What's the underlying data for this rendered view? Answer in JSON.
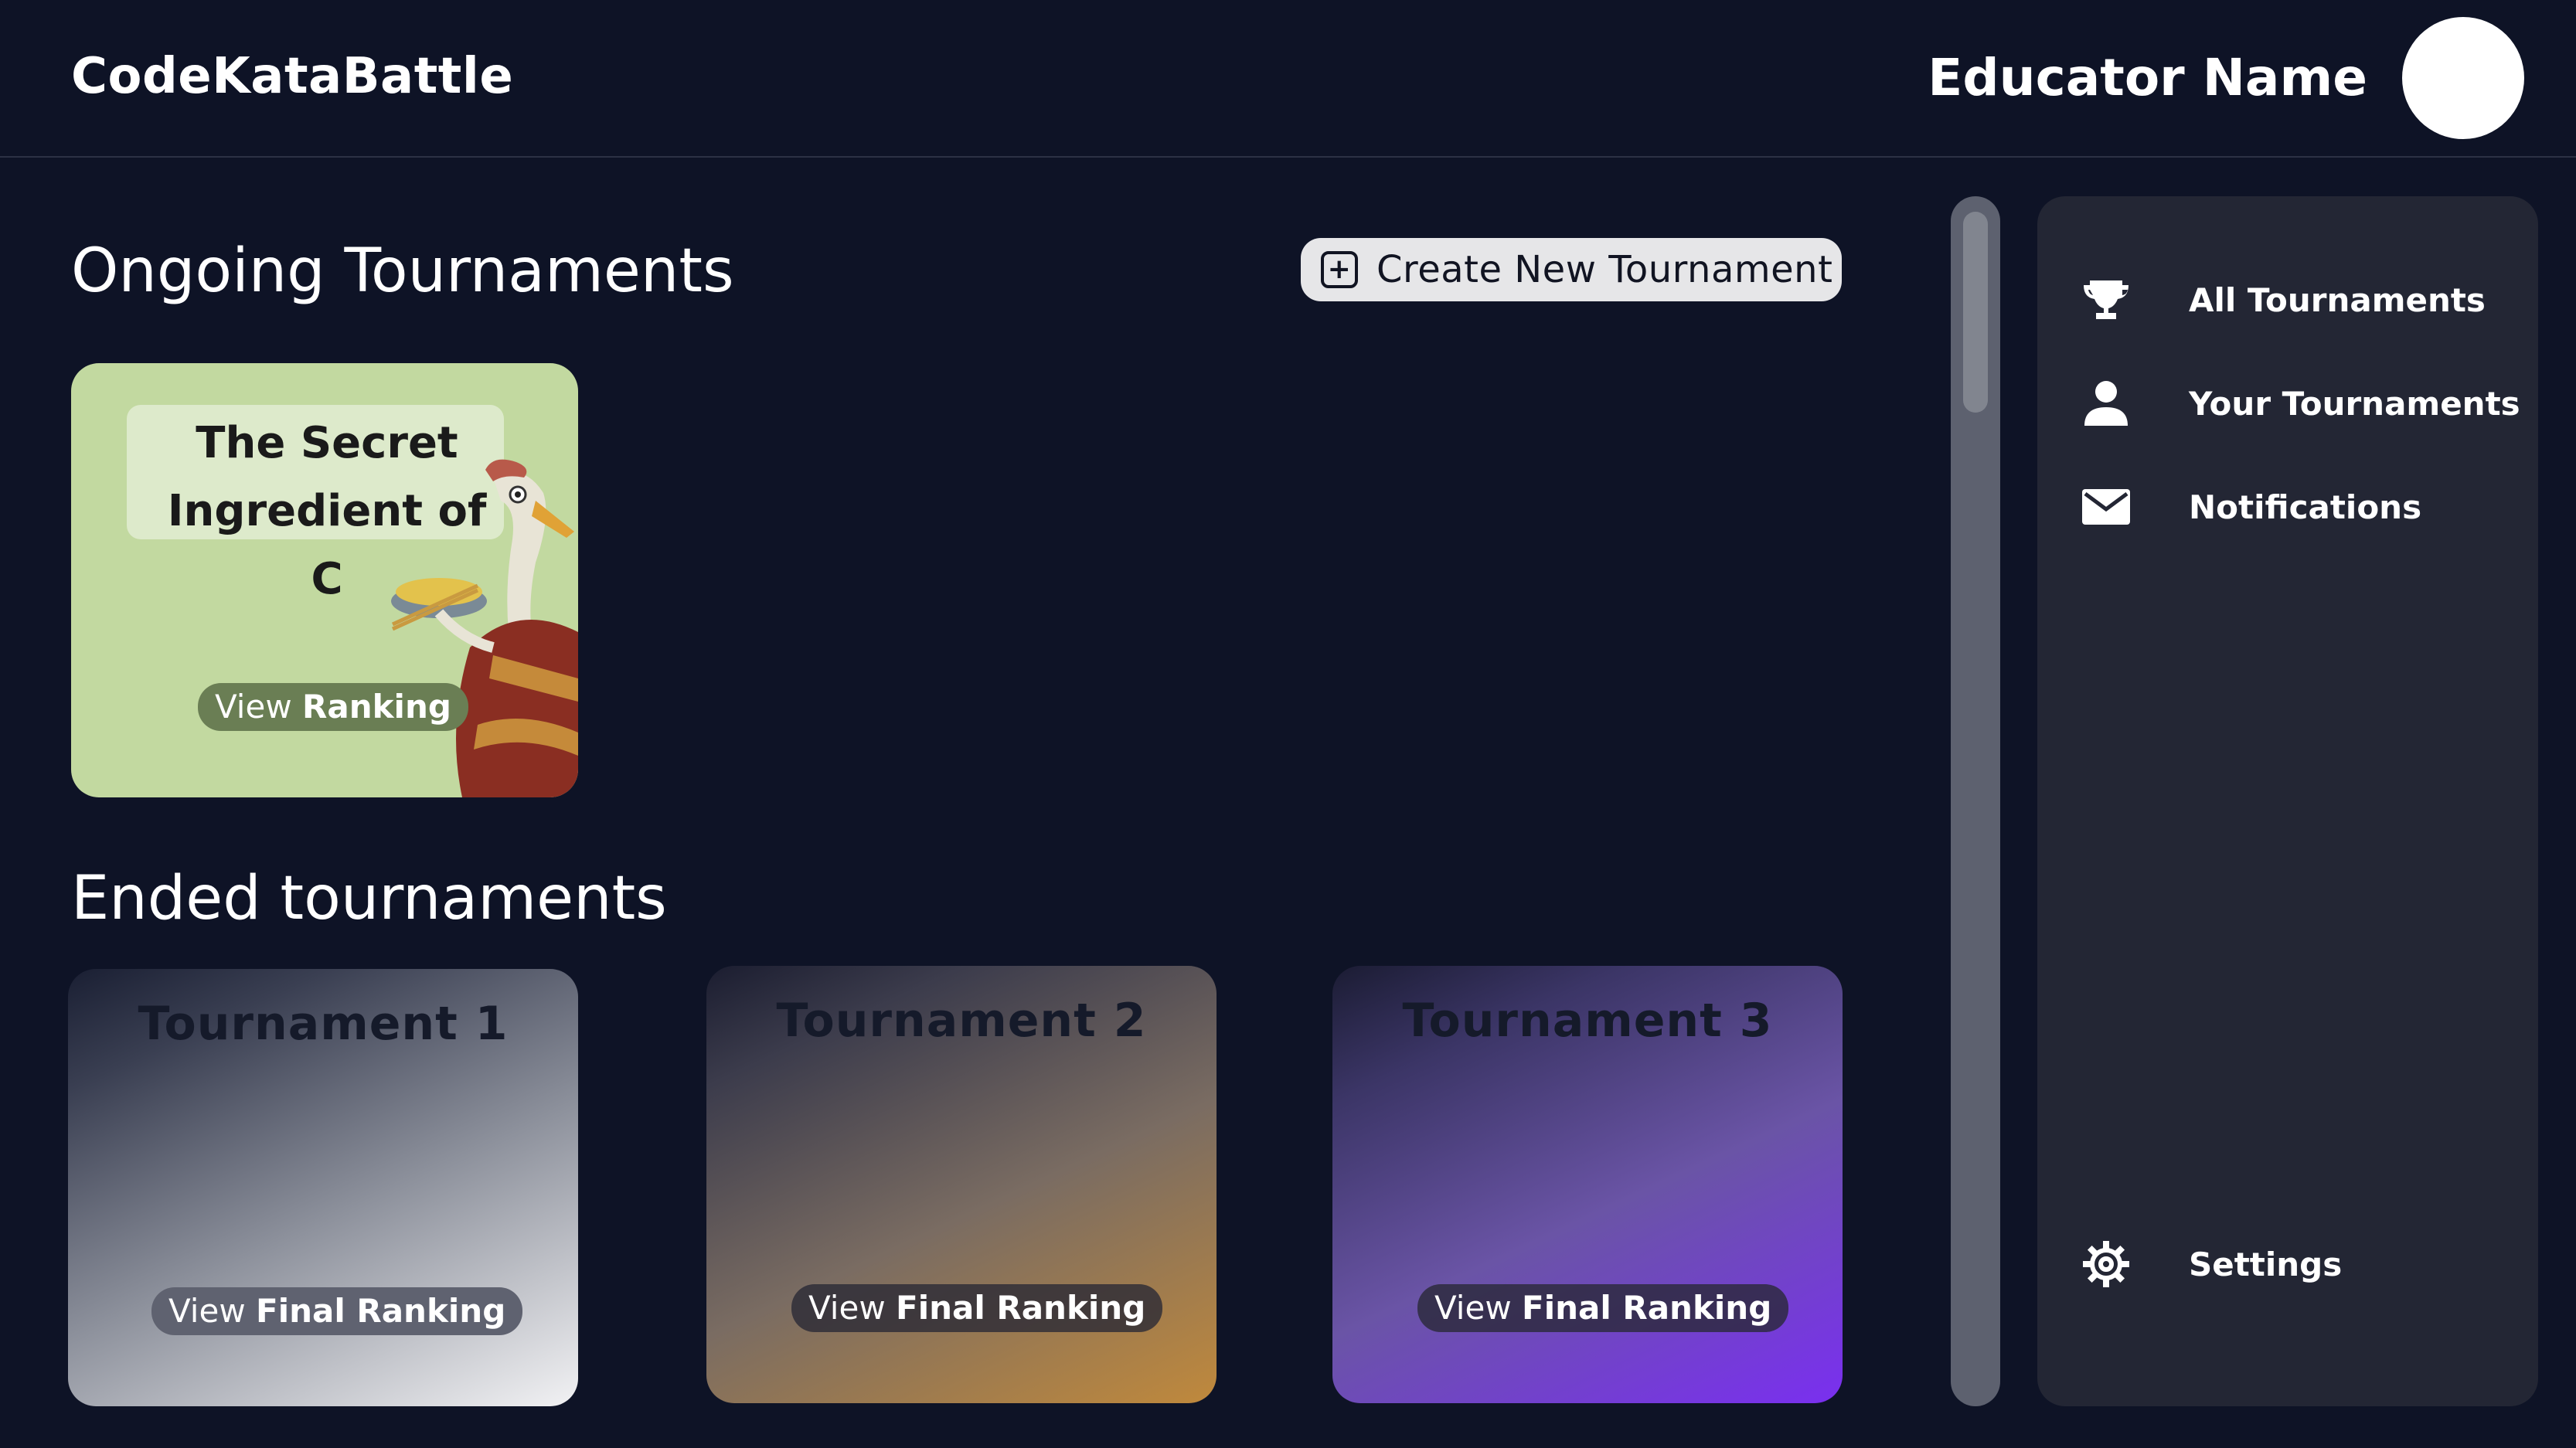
{
  "header": {
    "brand": "CodeKataBattle",
    "educator_name": "Educator Name"
  },
  "ongoing": {
    "section_title": "Ongoing Tournaments",
    "create_button_label": "Create New Tournament",
    "cards": [
      {
        "title": "The Secret Ingredient of C",
        "pill_prefix": "View",
        "pill_strong": "Ranking"
      }
    ]
  },
  "ended": {
    "section_title": "Ended tournaments",
    "cards": [
      {
        "title": "Tournament 1",
        "pill_prefix": "View",
        "pill_strong": "Final Ranking"
      },
      {
        "title": "Tournament  2",
        "pill_prefix": "View",
        "pill_strong": "Final Ranking"
      },
      {
        "title": "Tournament  3",
        "pill_prefix": "View",
        "pill_strong": "Final Ranking"
      }
    ]
  },
  "side_panel": {
    "items": [
      {
        "label": "All Tournaments",
        "icon": "trophy-icon"
      },
      {
        "label": "Your Tournaments",
        "icon": "user-icon"
      },
      {
        "label": "Notifications",
        "icon": "mail-icon"
      },
      {
        "label": "Settings",
        "icon": "gear-icon"
      }
    ]
  },
  "colors": {
    "background": "#0e1326",
    "panel": "#232634",
    "ongoing_card": "#c2d9a0",
    "button_bg": "#e6e6e8"
  }
}
